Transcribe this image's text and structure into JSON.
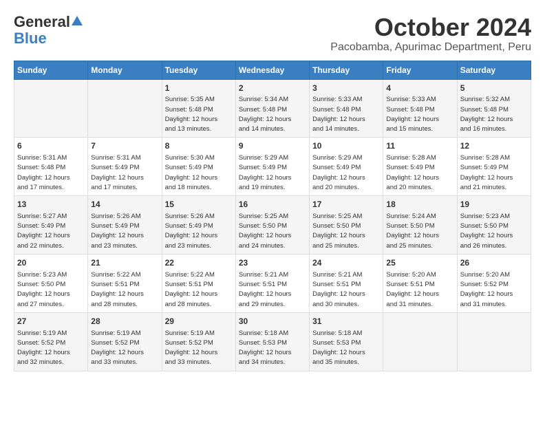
{
  "logo": {
    "general": "General",
    "blue": "Blue"
  },
  "title": "October 2024",
  "location": "Pacobamba, Apurimac Department, Peru",
  "headers": [
    "Sunday",
    "Monday",
    "Tuesday",
    "Wednesday",
    "Thursday",
    "Friday",
    "Saturday"
  ],
  "weeks": [
    [
      {
        "day": "",
        "detail": ""
      },
      {
        "day": "",
        "detail": ""
      },
      {
        "day": "1",
        "detail": "Sunrise: 5:35 AM\nSunset: 5:48 PM\nDaylight: 12 hours\nand 13 minutes."
      },
      {
        "day": "2",
        "detail": "Sunrise: 5:34 AM\nSunset: 5:48 PM\nDaylight: 12 hours\nand 14 minutes."
      },
      {
        "day": "3",
        "detail": "Sunrise: 5:33 AM\nSunset: 5:48 PM\nDaylight: 12 hours\nand 14 minutes."
      },
      {
        "day": "4",
        "detail": "Sunrise: 5:33 AM\nSunset: 5:48 PM\nDaylight: 12 hours\nand 15 minutes."
      },
      {
        "day": "5",
        "detail": "Sunrise: 5:32 AM\nSunset: 5:48 PM\nDaylight: 12 hours\nand 16 minutes."
      }
    ],
    [
      {
        "day": "6",
        "detail": "Sunrise: 5:31 AM\nSunset: 5:48 PM\nDaylight: 12 hours\nand 17 minutes."
      },
      {
        "day": "7",
        "detail": "Sunrise: 5:31 AM\nSunset: 5:49 PM\nDaylight: 12 hours\nand 17 minutes."
      },
      {
        "day": "8",
        "detail": "Sunrise: 5:30 AM\nSunset: 5:49 PM\nDaylight: 12 hours\nand 18 minutes."
      },
      {
        "day": "9",
        "detail": "Sunrise: 5:29 AM\nSunset: 5:49 PM\nDaylight: 12 hours\nand 19 minutes."
      },
      {
        "day": "10",
        "detail": "Sunrise: 5:29 AM\nSunset: 5:49 PM\nDaylight: 12 hours\nand 20 minutes."
      },
      {
        "day": "11",
        "detail": "Sunrise: 5:28 AM\nSunset: 5:49 PM\nDaylight: 12 hours\nand 20 minutes."
      },
      {
        "day": "12",
        "detail": "Sunrise: 5:28 AM\nSunset: 5:49 PM\nDaylight: 12 hours\nand 21 minutes."
      }
    ],
    [
      {
        "day": "13",
        "detail": "Sunrise: 5:27 AM\nSunset: 5:49 PM\nDaylight: 12 hours\nand 22 minutes."
      },
      {
        "day": "14",
        "detail": "Sunrise: 5:26 AM\nSunset: 5:49 PM\nDaylight: 12 hours\nand 23 minutes."
      },
      {
        "day": "15",
        "detail": "Sunrise: 5:26 AM\nSunset: 5:49 PM\nDaylight: 12 hours\nand 23 minutes."
      },
      {
        "day": "16",
        "detail": "Sunrise: 5:25 AM\nSunset: 5:50 PM\nDaylight: 12 hours\nand 24 minutes."
      },
      {
        "day": "17",
        "detail": "Sunrise: 5:25 AM\nSunset: 5:50 PM\nDaylight: 12 hours\nand 25 minutes."
      },
      {
        "day": "18",
        "detail": "Sunrise: 5:24 AM\nSunset: 5:50 PM\nDaylight: 12 hours\nand 25 minutes."
      },
      {
        "day": "19",
        "detail": "Sunrise: 5:23 AM\nSunset: 5:50 PM\nDaylight: 12 hours\nand 26 minutes."
      }
    ],
    [
      {
        "day": "20",
        "detail": "Sunrise: 5:23 AM\nSunset: 5:50 PM\nDaylight: 12 hours\nand 27 minutes."
      },
      {
        "day": "21",
        "detail": "Sunrise: 5:22 AM\nSunset: 5:51 PM\nDaylight: 12 hours\nand 28 minutes."
      },
      {
        "day": "22",
        "detail": "Sunrise: 5:22 AM\nSunset: 5:51 PM\nDaylight: 12 hours\nand 28 minutes."
      },
      {
        "day": "23",
        "detail": "Sunrise: 5:21 AM\nSunset: 5:51 PM\nDaylight: 12 hours\nand 29 minutes."
      },
      {
        "day": "24",
        "detail": "Sunrise: 5:21 AM\nSunset: 5:51 PM\nDaylight: 12 hours\nand 30 minutes."
      },
      {
        "day": "25",
        "detail": "Sunrise: 5:20 AM\nSunset: 5:51 PM\nDaylight: 12 hours\nand 31 minutes."
      },
      {
        "day": "26",
        "detail": "Sunrise: 5:20 AM\nSunset: 5:52 PM\nDaylight: 12 hours\nand 31 minutes."
      }
    ],
    [
      {
        "day": "27",
        "detail": "Sunrise: 5:19 AM\nSunset: 5:52 PM\nDaylight: 12 hours\nand 32 minutes."
      },
      {
        "day": "28",
        "detail": "Sunrise: 5:19 AM\nSunset: 5:52 PM\nDaylight: 12 hours\nand 33 minutes."
      },
      {
        "day": "29",
        "detail": "Sunrise: 5:19 AM\nSunset: 5:52 PM\nDaylight: 12 hours\nand 33 minutes."
      },
      {
        "day": "30",
        "detail": "Sunrise: 5:18 AM\nSunset: 5:53 PM\nDaylight: 12 hours\nand 34 minutes."
      },
      {
        "day": "31",
        "detail": "Sunrise: 5:18 AM\nSunset: 5:53 PM\nDaylight: 12 hours\nand 35 minutes."
      },
      {
        "day": "",
        "detail": ""
      },
      {
        "day": "",
        "detail": ""
      }
    ]
  ]
}
